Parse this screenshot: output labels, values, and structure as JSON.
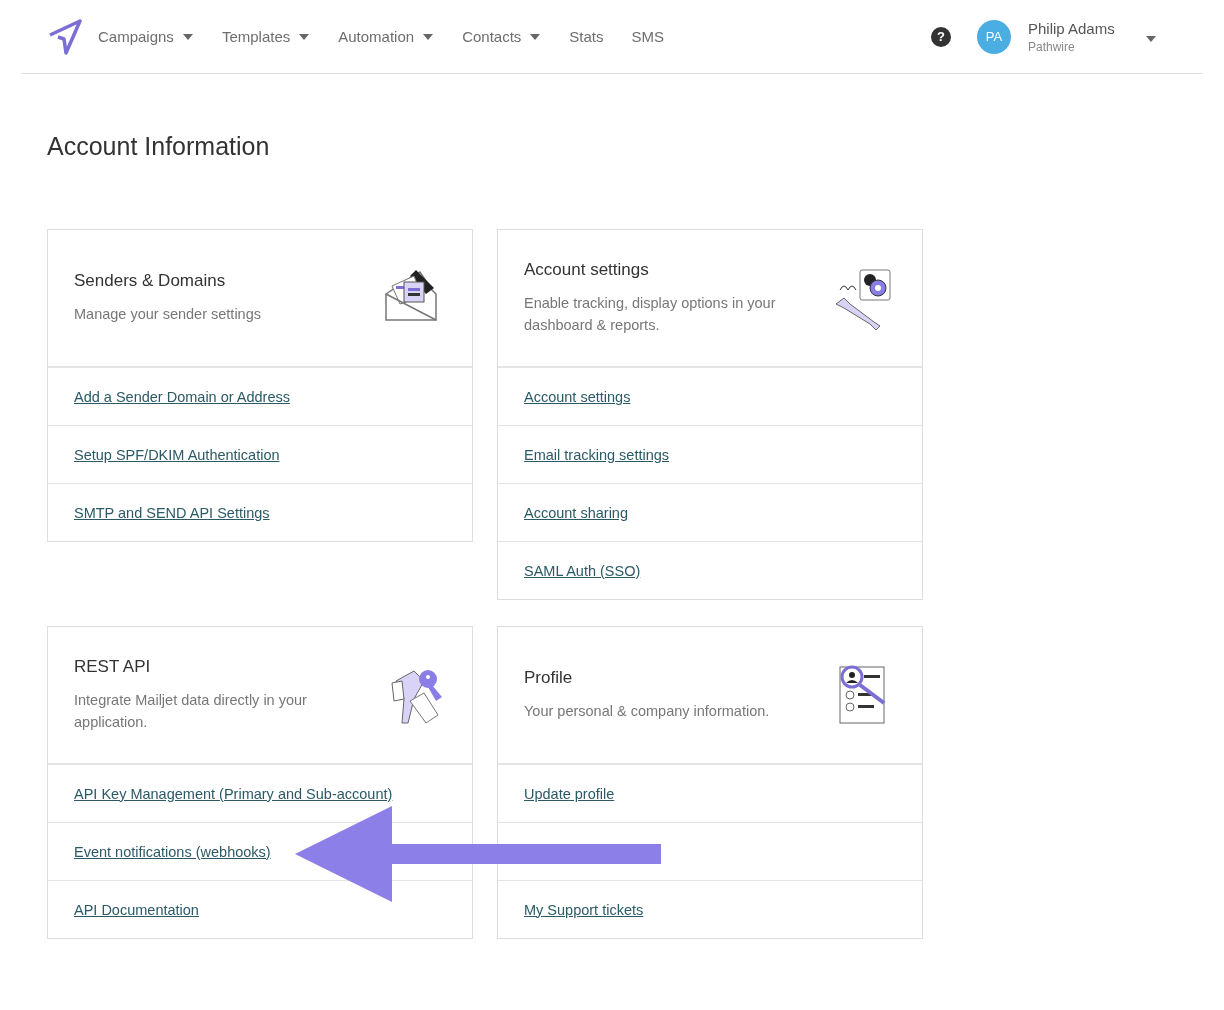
{
  "nav": {
    "items": [
      {
        "label": "Campaigns",
        "dropdown": true
      },
      {
        "label": "Templates",
        "dropdown": true
      },
      {
        "label": "Automation",
        "dropdown": true
      },
      {
        "label": "Contacts",
        "dropdown": true
      },
      {
        "label": "Stats",
        "dropdown": false
      },
      {
        "label": "SMS",
        "dropdown": false
      }
    ],
    "help": "?",
    "user": {
      "initials": "PA",
      "name": "Philip Adams",
      "company": "Pathwire"
    }
  },
  "title": "Account Information",
  "cards": [
    {
      "title": "Senders & Domains",
      "description": "Manage your sender settings",
      "rows": [
        {
          "kind": "link",
          "label": "Add a Sender Domain or Address"
        },
        {
          "kind": "link",
          "label": "Setup SPF/DKIM Authentication"
        },
        {
          "kind": "link",
          "label": "SMTP and SEND API Settings"
        }
      ]
    },
    {
      "title": "Account settings",
      "description": "Enable tracking, display options in your dashboard & reports.",
      "rows": [
        {
          "kind": "link",
          "label": "Account settings"
        },
        {
          "kind": "link",
          "label": "Email tracking settings"
        },
        {
          "kind": "link",
          "label": "Account sharing"
        },
        {
          "kind": "link",
          "label": "SAML Auth (SSO)"
        }
      ]
    },
    {
      "title": "REST API",
      "description": "Integrate Mailjet data directly in your application.",
      "rows": [
        {
          "kind": "link",
          "label": "API Key Management (Primary and Sub-account)"
        },
        {
          "kind": "link",
          "label": "Event notifications (webhooks)"
        },
        {
          "kind": "link",
          "label": "API Documentation"
        }
      ]
    },
    {
      "title": "Profile",
      "description": "Your personal & company information.",
      "rows": [
        {
          "kind": "link",
          "label": "Update profile"
        },
        {
          "kind": "empty"
        },
        {
          "kind": "link",
          "label": "My Support tickets"
        }
      ]
    }
  ]
}
